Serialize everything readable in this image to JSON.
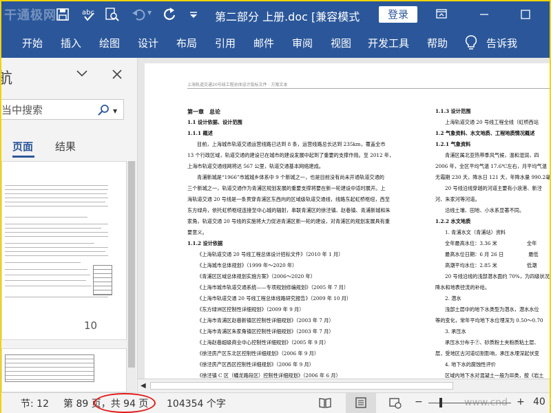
{
  "titlebar": {
    "watermark": "干通极网",
    "title": "第二部分 上册.doc [兼容模式",
    "login_label": "登录"
  },
  "ribbon": {
    "tabs": [
      "开始",
      "插入",
      "绘图",
      "设计",
      "布局",
      "引用",
      "邮件",
      "审阅",
      "视图",
      "开发工具",
      "帮助"
    ],
    "tell_me": "告诉我"
  },
  "nav": {
    "title": "航",
    "search_placeholder": "当中搜索",
    "tab_pages": "页面",
    "tab_results": "结果",
    "thumb_page_number": "10"
  },
  "document": {
    "header": "上海轨道交通20号线工程总体设计投标文件 · 方案文本",
    "left_col": [
      {
        "t": "第一章　总论",
        "c": "h1"
      },
      {
        "t": "1.1 设计依据、设计范围",
        "c": "h2"
      },
      {
        "t": "1.1.1 概述",
        "c": "h2"
      },
      {
        "t": "目前，上海城市轨道交通运营线路已达到 8 条，运营线路总长达到 235km，覆盖全市",
        "c": "indent"
      },
      {
        "t": "13 个行政区域，轨道交通的建设已在城市的建设发展中起到了重要的支撑作用。至 2012 年，",
        "c": ""
      },
      {
        "t": "上海市轨道交通线网将达 567 公里，轨道交通基本网络建成。",
        "c": ""
      },
      {
        "t": "青浦新城是“1966”市城城乡体系中 9 个新城之一，也是目前没有尚未开通轨道交通的",
        "c": "indent"
      },
      {
        "t": "三个新城之一，轨道交通作为青浦区规划发展的重要支撑将要在新一轮建设中适时展开。上",
        "c": ""
      },
      {
        "t": "海轨道交通 20 号线是一条贯穿青浦区东西向的区域级轨道交通线，线路东起虹桥枢纽，西至",
        "c": ""
      },
      {
        "t": "东方绿舟，依托虹桥枢纽连接至中心城的辐射，串联青浦区的徐泾镇、赵巷镇、青浦新城和朱",
        "c": ""
      },
      {
        "t": "家角，轨道交通 20 号线的实施将大力促进青浦区新一轮的建设，对青浦区的规划发展具有重",
        "c": ""
      },
      {
        "t": "要意义。",
        "c": ""
      },
      {
        "t": "1.1.2 设计依据",
        "c": "h2"
      },
      {
        "t": "《上海轨道交通 20 号线工程总体设计招标文件》（2010 年 1 月）",
        "c": "indent"
      },
      {
        "t": "《上海城市总体规划》（1999 年～2020 年）",
        "c": "indent"
      },
      {
        "t": "《青浦区区域总体规划实施方案》（2006～2020 年）",
        "c": "indent"
      },
      {
        "t": "《上海市城市轨道交通系统——专项规划修编规划》（2005 年 7 月）",
        "c": "indent"
      },
      {
        "t": "《上海市轨道交通 20 号线工程总体线路研究报告》（2009 年 10 月）",
        "c": "indent"
      },
      {
        "t": "《东方绿洲区控制性详细规划》（2009 年 9 月）",
        "c": "indent"
      },
      {
        "t": "《上海市青浦区赵巷新镇区控制性详细规划》（2003 年 7 月）",
        "c": "indent"
      },
      {
        "t": "《上海市青浦区朱家角镇区控制性详细规划》（2003 年 7 月）",
        "c": "indent"
      },
      {
        "t": "《上海赵巷超级商业中心控制性详细规划》（2005 年 9 月）",
        "c": "indent"
      },
      {
        "t": "《徐泾房产区东北区控制性详细规划》（2006 年 9 月）",
        "c": "indent"
      },
      {
        "t": "《徐泾房产区西区控制性详细规划》（2006 年 9 月）",
        "c": "indent"
      },
      {
        "t": "《徐泾镇 C 区（蟠龙路段区）控制性详细规划》（2006 年 6 月）",
        "c": "indent"
      }
    ],
    "right_col": [
      {
        "t": "1.1.3 设计范围",
        "c": "h2"
      },
      {
        "t": "上海轨道交通 20 号线工程全线（虹桥西站",
        "c": "indent"
      },
      {
        "t": "1.2 气象资料、水文地质、工程地质情况概述",
        "c": "h2"
      },
      {
        "t": "1.2.1 气象资料",
        "c": "h2"
      },
      {
        "t": "青浦区属北亚热带季风气候，温和湿润，四",
        "c": "indent"
      },
      {
        "t": "2006 年，全区平均气温 17.6℃左右，月平均气温",
        "c": ""
      },
      {
        "t": "无霜期 230 天，降水日 121 天，年降水量 990.2毫",
        "c": ""
      },
      {
        "t": "20 号线沿线穿越的河道主要有小浪港、新泾",
        "c": "indent"
      },
      {
        "t": "河、朱家河等河道。",
        "c": ""
      },
      {
        "t": "沿线土壤、田地、小水系显著不同。",
        "c": "indent"
      },
      {
        "t": "1.2.2 水文地质",
        "c": "h2"
      },
      {
        "t": "1. 青浦水文（青浦站）资料",
        "c": "indent"
      },
      {
        "t": "全年最高水位：3.36 米　　　　　　全年",
        "c": "indent"
      },
      {
        "t": "最高水位日期：6 月 26 日　　　　　最低",
        "c": "indent"
      },
      {
        "t": "高潮平均水位：2.85 米　　　　　　低潮",
        "c": "indent"
      },
      {
        "t": "20 号线沿线的浅部潜水面约 70%，为四级状况",
        "c": "indent"
      },
      {
        "t": "降水和地表径流的补给。",
        "c": ""
      },
      {
        "t": "2. 潜水",
        "c": "indent"
      },
      {
        "t": "浅部土层中的地下水类型为潜水，潜水水位",
        "c": "indent"
      },
      {
        "t": "等的变化，常年平均地下水位埋深为 0.50～0.70",
        "c": ""
      },
      {
        "t": "3. 承压水",
        "c": "indent"
      },
      {
        "t": "承压水分布于⑦、砂质粉土夹粉质粘土层、",
        "c": "indent"
      },
      {
        "t": "层，受地区古河道切割影响，承压水埋深起伏变",
        "c": ""
      },
      {
        "t": "4. 地下水的腐蚀性评价",
        "c": "indent"
      },
      {
        "t": "区域内地下水对混凝土一般为Ⅲ类，按《岩土",
        "c": "indent"
      }
    ]
  },
  "status": {
    "section": "节: 12",
    "page": "第 89 页，共 94 页",
    "words": "104354 个字",
    "zoom": "40",
    "watermark_url": "www.cnd"
  }
}
